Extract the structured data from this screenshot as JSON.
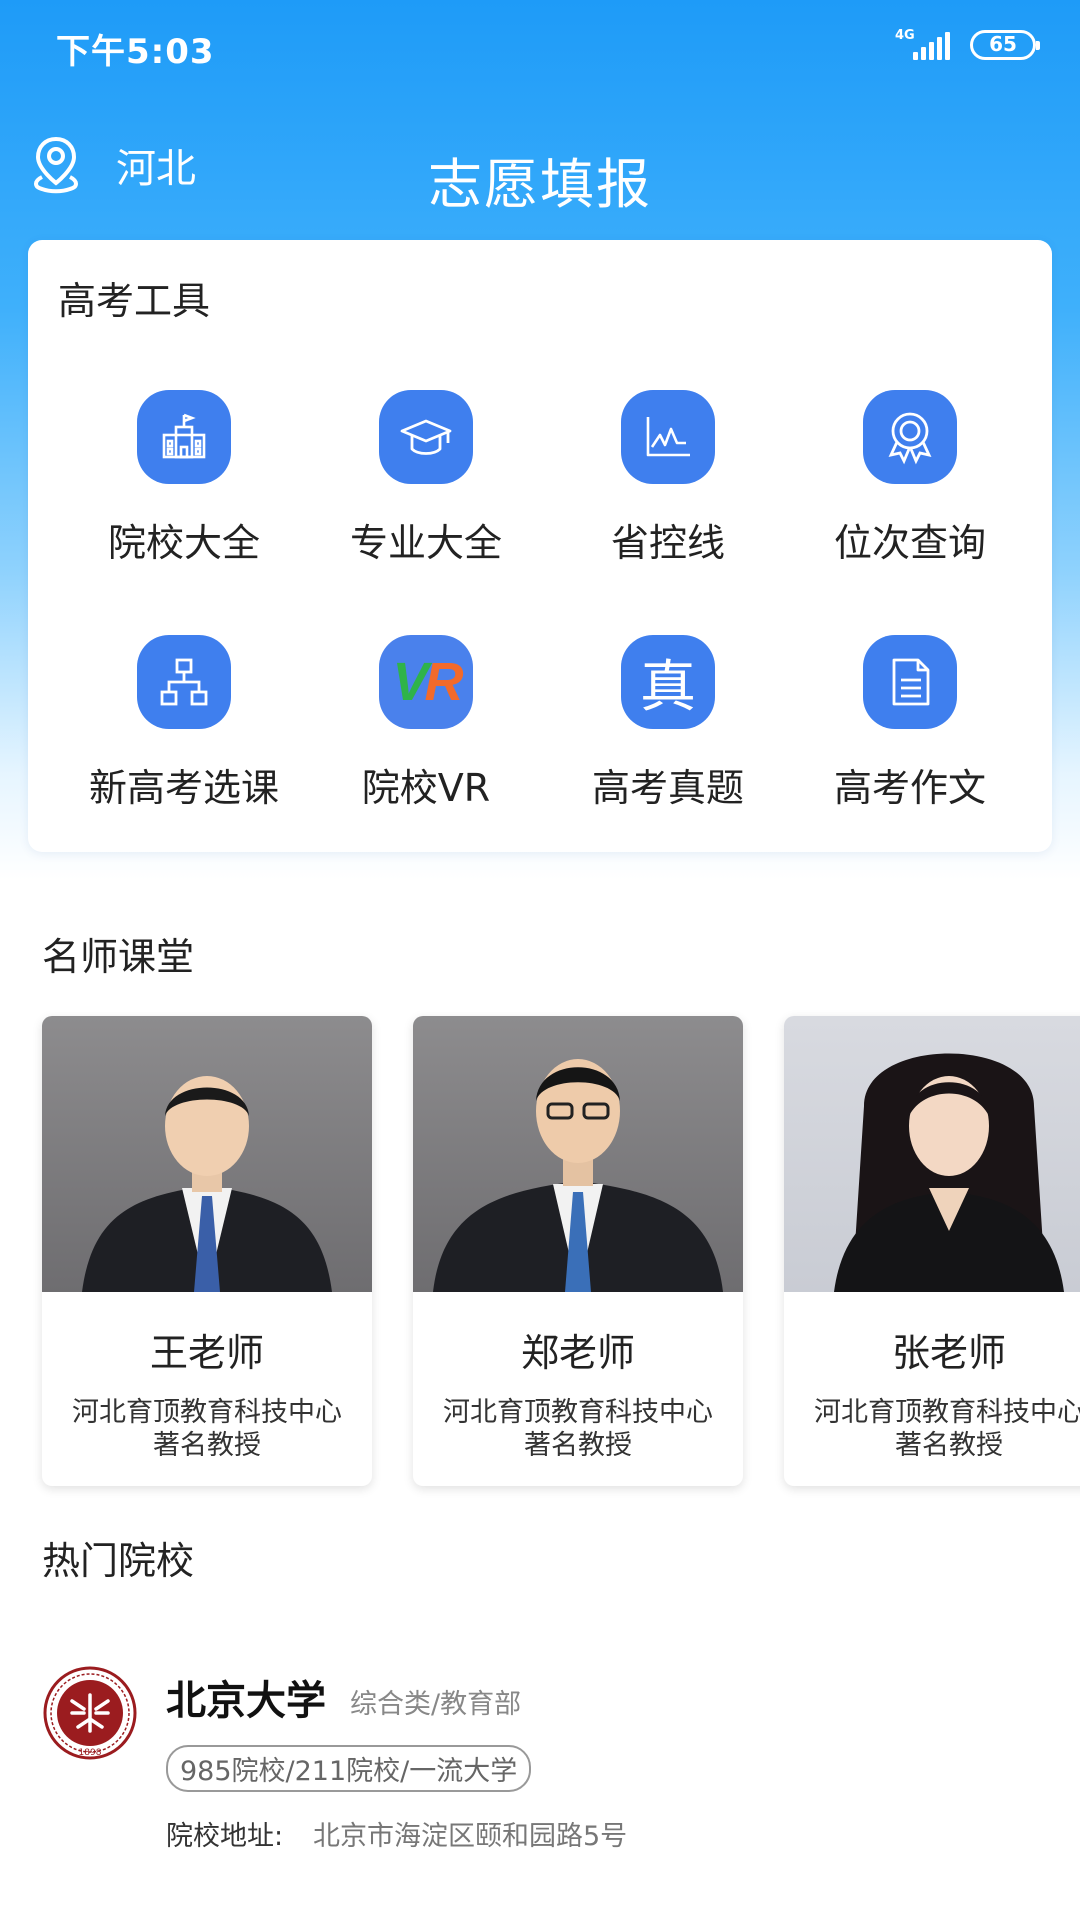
{
  "status_bar": {
    "time": "下午5:03",
    "network": "4G",
    "battery": "65"
  },
  "header": {
    "location": "河北",
    "title": "志愿填报"
  },
  "tools": {
    "title": "高考工具",
    "items": [
      {
        "label": "院校大全",
        "icon": "school-building-icon"
      },
      {
        "label": "专业大全",
        "icon": "graduation-cap-icon"
      },
      {
        "label": "省控线",
        "icon": "line-chart-icon"
      },
      {
        "label": "位次查询",
        "icon": "award-medal-icon"
      },
      {
        "label": "新高考选课",
        "icon": "hierarchy-icon"
      },
      {
        "label": "院校VR",
        "icon": "vr-logo-icon"
      },
      {
        "label": "高考真题",
        "icon": "zhen-character-icon"
      },
      {
        "label": "高考作文",
        "icon": "document-icon"
      }
    ],
    "vr_text": {
      "v": "V",
      "r": "R"
    },
    "zhen_char": "真",
    "colors": {
      "icon_bg": "#3f7fee",
      "header_gradient_top": "#1e9bf8"
    }
  },
  "teachers": {
    "title": "名师课堂",
    "items": [
      {
        "name": "王老师",
        "org": "河北育顶教育科技中心",
        "title": "著名教授"
      },
      {
        "name": "郑老师",
        "org": "河北育顶教育科技中心",
        "title": "著名教授"
      },
      {
        "name": "张老师",
        "org": "河北育顶教育科技中心",
        "title": "著名教授"
      }
    ]
  },
  "hot_schools": {
    "title": "热门院校",
    "items": [
      {
        "name": "北京大学",
        "type": "综合类/教育部",
        "tags": "985院校/211院校/一流大学",
        "address_label": "院校地址:",
        "address": "北京市海淀区颐和园路5号",
        "logo": "peking-university-seal-icon",
        "logo_year": "1898",
        "logo_color": "#9b1c1f"
      }
    ]
  }
}
